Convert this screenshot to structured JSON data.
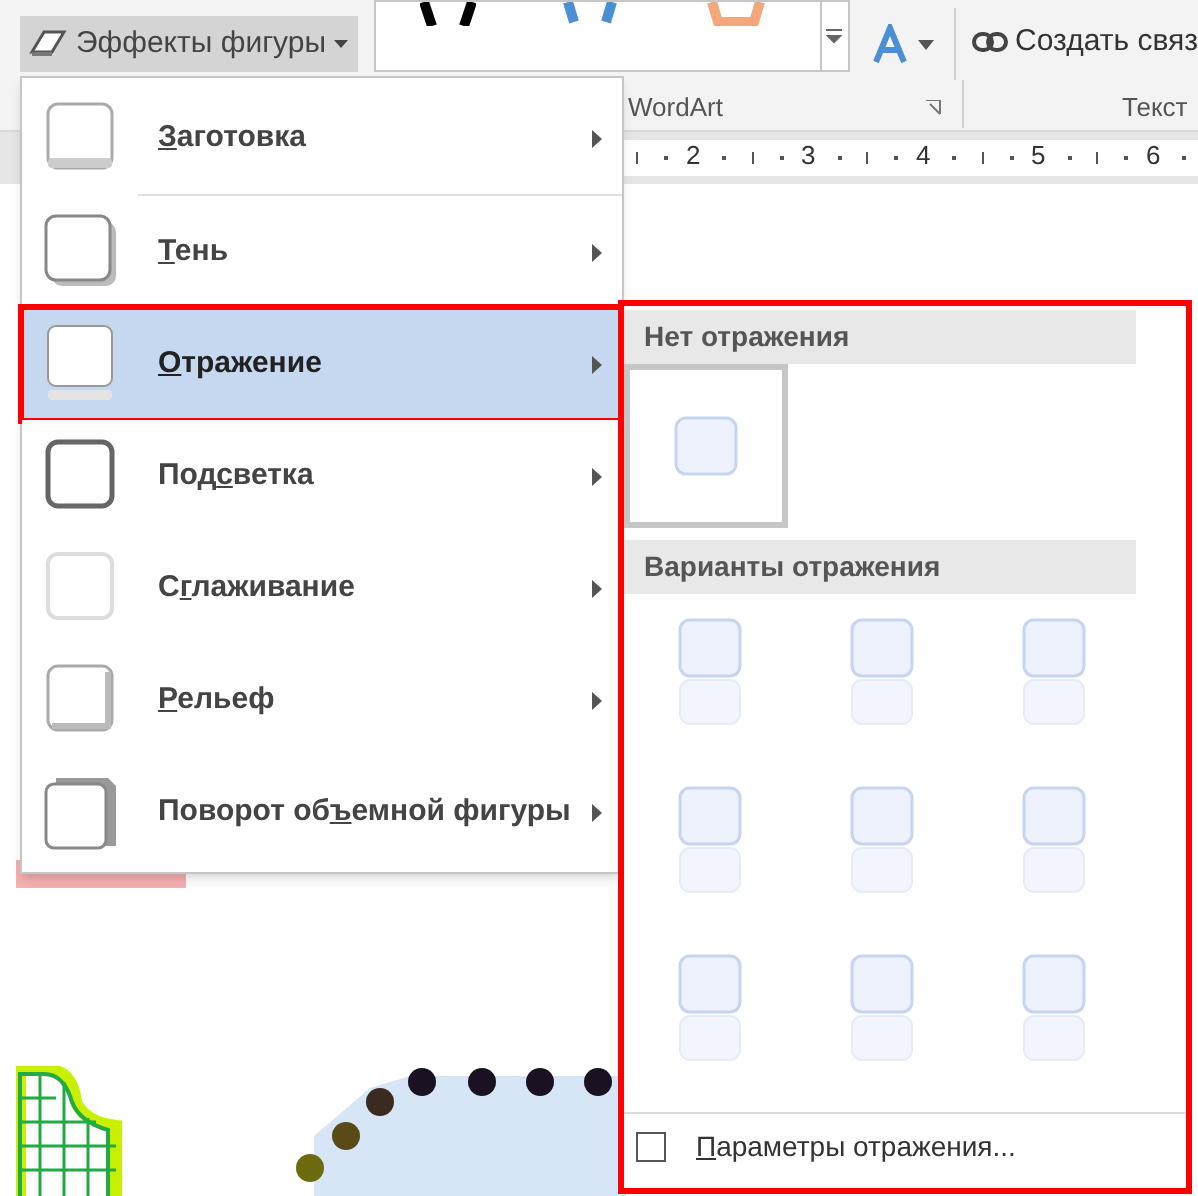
{
  "ribbon": {
    "shape_effects_button": "Эффекты фигуры",
    "create_link_button": "Создать связ",
    "groups": [
      "WordArt",
      "Текст"
    ],
    "ruler_numbers": [
      "2",
      "3",
      "4",
      "5",
      "6"
    ]
  },
  "effects_menu": {
    "items": [
      {
        "access_key": "З",
        "label_after": "аготовка",
        "selected": false,
        "kind": "preset"
      },
      {
        "access_key": "Т",
        "label_after": "ень",
        "selected": false,
        "kind": "shadow"
      },
      {
        "access_key": "О",
        "label_after": "тражение",
        "selected": true,
        "kind": "reflection"
      },
      {
        "label_before": "Под",
        "access_key": "с",
        "label_after": "ветка",
        "selected": false,
        "kind": "glow"
      },
      {
        "label_before": "С",
        "access_key": "г",
        "label_after": "лаживание",
        "selected": false,
        "kind": "soft"
      },
      {
        "access_key": "Р",
        "label_after": "ельеф",
        "selected": false,
        "kind": "bevel"
      },
      {
        "label_before": "Поворот об",
        "access_key": "ъ",
        "label_after": "емной фигуры",
        "selected": false,
        "kind": "rotation"
      }
    ]
  },
  "reflection_submenu": {
    "sections": [
      {
        "title": "Нет отражения",
        "kind": "none",
        "options": [
          {
            "selected": true
          }
        ]
      },
      {
        "title": "Варианты отражения",
        "kind": "variants",
        "options": [
          {
            "selected": false
          },
          {
            "selected": false
          },
          {
            "selected": false
          },
          {
            "selected": false
          },
          {
            "selected": false
          },
          {
            "selected": false
          },
          {
            "selected": false
          },
          {
            "selected": false
          },
          {
            "selected": false
          }
        ]
      }
    ],
    "options_link": {
      "access_key": "П",
      "label_after": "араметры отражения...",
      "checked": false
    }
  }
}
